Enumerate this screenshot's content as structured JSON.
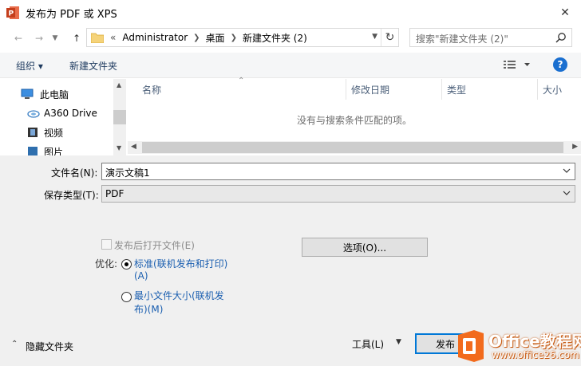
{
  "window": {
    "title": "发布为 PDF 或 XPS",
    "close_label": "✕"
  },
  "address_bar": {
    "prefix": "«",
    "crumbs": [
      "Administrator",
      "桌面",
      "新建文件夹 (2)"
    ]
  },
  "search": {
    "placeholder": "搜索\"新建文件夹 (2)\""
  },
  "toolbar": {
    "organize_label": "组织 ▾",
    "new_folder_label": "新建文件夹",
    "help_label": "?"
  },
  "nav_pane": {
    "items": [
      {
        "label": "此电脑",
        "icon": "computer-icon"
      },
      {
        "label": "A360 Drive",
        "icon": "cloud-drive-icon"
      },
      {
        "label": "视频",
        "icon": "video-icon"
      },
      {
        "label": "图片",
        "icon": "pictures-icon"
      }
    ]
  },
  "file_list": {
    "columns": [
      "名称",
      "修改日期",
      "类型",
      "大小"
    ],
    "empty_message": "没有与搜索条件匹配的项。"
  },
  "form": {
    "filename_label": "文件名(N):",
    "filename_value": "演示文稿1",
    "filetype_label": "保存类型(T):",
    "filetype_value": "PDF",
    "open_after_label": "发布后打开文件(E)",
    "options_button": "选项(O)...",
    "optimize_label": "优化:",
    "opt_standard_line1": "标准(联机发布和打印)",
    "opt_standard_line2": "(A)",
    "opt_min_line1": "最小文件大小(联机发",
    "opt_min_line2": "布)(M)"
  },
  "footer": {
    "hide_folders_label": "隐藏文件夹",
    "tools_label": "工具(L)",
    "publish_label": "发布"
  },
  "watermark": {
    "brand": "Office教程网",
    "url": "www.office26.com"
  },
  "colors": {
    "accent": "#0078d7",
    "ppt_red": "#c43e1c",
    "watermark_orange": "#f26b1d"
  }
}
